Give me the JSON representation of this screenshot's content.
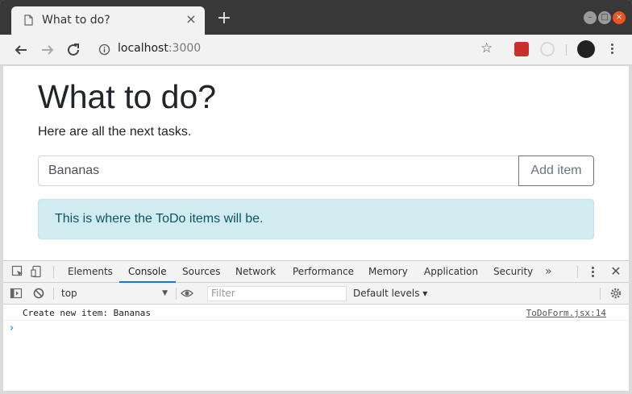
{
  "browser": {
    "tab_title": "What to do?",
    "new_tab_label": "+",
    "url_host": "localhost",
    "url_port": ":3000"
  },
  "page": {
    "title": "What to do?",
    "subtitle": "Here are all the next tasks.",
    "input_value": "Bananas",
    "add_button": "Add item",
    "alert_text": "This is where the ToDo items will be.",
    "colors": {
      "alert_bg": "#d1ecf1",
      "alert_text": "#0c5460",
      "button_border": "#6c757d"
    }
  },
  "devtools": {
    "tabs": [
      "Elements",
      "Console",
      "Sources",
      "Network",
      "Performance",
      "Memory",
      "Application",
      "Security"
    ],
    "active_tab": "Console",
    "more_label": "»",
    "context": "top",
    "filter_placeholder": "Filter",
    "levels": "Default levels ▾",
    "log": {
      "message": "Create new item: Bananas",
      "source": "ToDoForm.jsx:14"
    },
    "prompt": "›"
  }
}
